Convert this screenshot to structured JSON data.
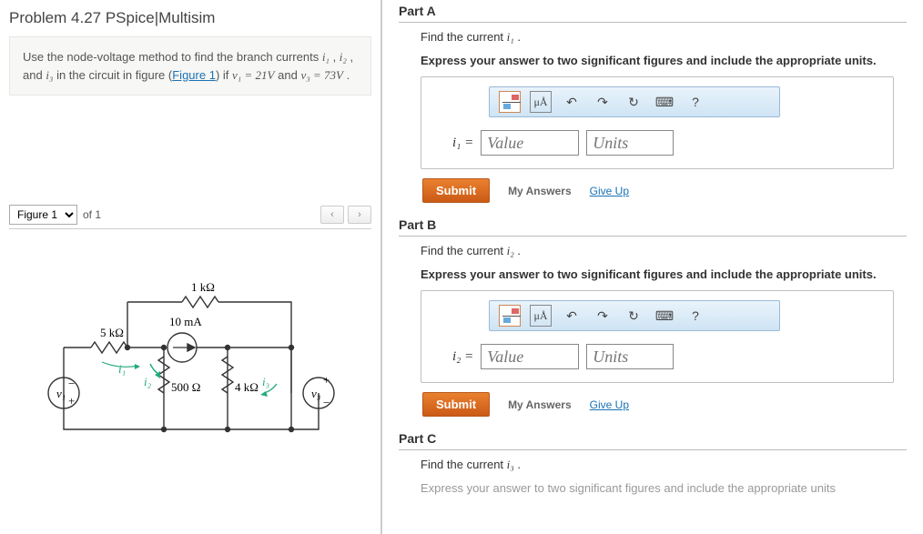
{
  "problem": {
    "title": "Problem 4.27 PSpice|Multisim",
    "text_1": "Use the node-voltage method to find the branch currents ",
    "i1": "i₁",
    "comma": " , ",
    "i2": "i₂",
    "and": " , and ",
    "i3": "i₃",
    "text_2": " in the circuit in figure (",
    "fig_link": "Figure 1",
    "text_3": ") if ",
    "v1eq": "v₁ = 21V",
    "text_4": " and ",
    "v3eq": "v₃ = 73V",
    "period": " ."
  },
  "figure": {
    "select": "Figure 1",
    "of_label": "of 1",
    "prev": "‹",
    "next": "›",
    "labels": {
      "r1": "1 kΩ",
      "r5": "5 kΩ",
      "isrc": "10 mA",
      "r500": "500 Ω",
      "r4": "4 kΩ",
      "v1": "v₁",
      "v3": "v₃",
      "i1": "i₁",
      "i2": "i₂",
      "i3": "i₃"
    }
  },
  "toolbar": {
    "unit_btn": "μÅ",
    "undo": "↶",
    "redo": "↷",
    "reset": "↻",
    "keyboard": "⌨",
    "help": "?"
  },
  "partA": {
    "title": "Part A",
    "find": "Find the current ",
    "var": "i₁",
    "dot": " .",
    "express": "Express your answer to two significant figures and include the appropriate units.",
    "lhs": "i₁ =",
    "value_ph": "Value",
    "units_ph": "Units",
    "submit": "Submit",
    "myans": "My Answers",
    "giveup": "Give Up"
  },
  "partB": {
    "title": "Part B",
    "find": "Find the current ",
    "var": "i₂",
    "dot": " .",
    "express": "Express your answer to two significant figures and include the appropriate units.",
    "lhs": "i₂ =",
    "value_ph": "Value",
    "units_ph": "Units",
    "submit": "Submit",
    "myans": "My Answers",
    "giveup": "Give Up"
  },
  "partC": {
    "title": "Part C",
    "find": "Find the current ",
    "var": "i₃",
    "dot": " .",
    "express_cut": "Express your answer to two significant figures and include the appropriate units"
  }
}
